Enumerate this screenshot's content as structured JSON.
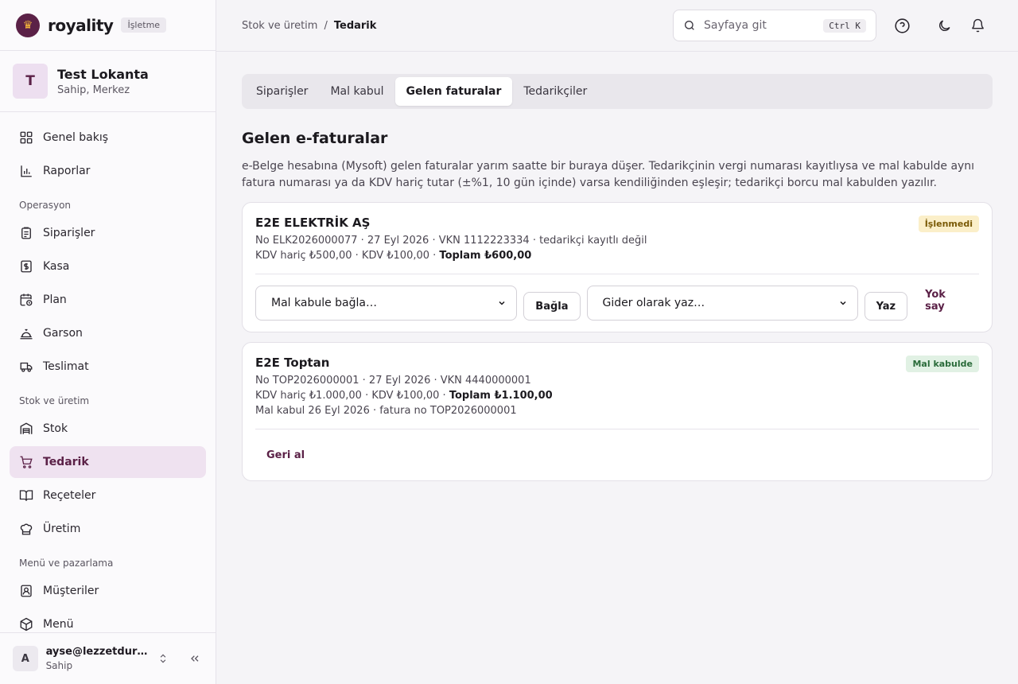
{
  "brand": {
    "name": "royality",
    "badge": "İşletme"
  },
  "org": {
    "initial": "T",
    "name": "Test Lokanta",
    "role": "Sahip, Merkez"
  },
  "nav": {
    "overview": "Genel bakış",
    "reports": "Raporlar",
    "section_ops": "Operasyon",
    "orders": "Siparişler",
    "cash": "Kasa",
    "plan": "Plan",
    "waiter": "Garson",
    "delivery": "Teslimat",
    "section_stock": "Stok ve üretim",
    "stock": "Stok",
    "supply": "Tedarik",
    "recipes": "Reçeteler",
    "production": "Üretim",
    "section_menu": "Menü ve pazarlama",
    "customers": "Müşteriler",
    "menu": "Menü"
  },
  "user": {
    "initial": "A",
    "email": "ayse@lezzetdurağı.com",
    "role": "Sahip"
  },
  "breadcrumb": {
    "parent": "Stok ve üretim",
    "separator": "/",
    "current": "Tedarik"
  },
  "search": {
    "placeholder": "Sayfaya git",
    "shortcut": "Ctrl K"
  },
  "tabs": [
    {
      "label": "Siparişler"
    },
    {
      "label": "Mal kabul"
    },
    {
      "label": "Gelen faturalar",
      "active": true
    },
    {
      "label": "Tedarikçiler"
    }
  ],
  "page": {
    "title": "Gelen e-faturalar",
    "description": "e-Belge hesabına (Mysoft) gelen faturalar yarım saatte bir buraya düşer. Tedarikçinin vergi numarası kayıtlıysa ve mal kabulde aynı fatura numarası ya da KDV hariç tutar (±%1, 10 gün içinde) varsa kendiliğinden eşleşir; tedarikçi borcu mal kabulden yazılır."
  },
  "invoices": [
    {
      "supplier": "E2E ELEKTRİK AŞ",
      "status": "İşlenmedi",
      "info": "No ELK2026000077 · 27 Eyl 2026 · VKN 1112223334 · tedarikçi kayıtlı değil",
      "amounts": "KDV hariç ₺500,00 · KDV ₺100,00 · ",
      "total": "Toplam ₺600,00",
      "link_select": "Mal kabule bağla…",
      "link_button": "Bağla",
      "expense_select": "Gider olarak yaz…",
      "expense_button": "Yaz",
      "ignore_button": "Yok say"
    },
    {
      "supplier": "E2E Toptan",
      "status": "Mal kabulde",
      "info": "No TOP2026000001 · 27 Eyl 2026 · VKN 4440000001",
      "amounts": "KDV hariç ₺1.000,00 · KDV ₺100,00 · ",
      "total": "Toplam ₺1.100,00",
      "receipt_info": "Mal kabul 26 Eyl 2026 · fatura no TOP2026000001",
      "undo_button": "Geri al"
    }
  ],
  "colors": {
    "brand": "#5b2147",
    "active_nav_bg": "#efe2f0",
    "warn_badge": "#fbefc9",
    "ok_badge": "#e1f1e4"
  }
}
